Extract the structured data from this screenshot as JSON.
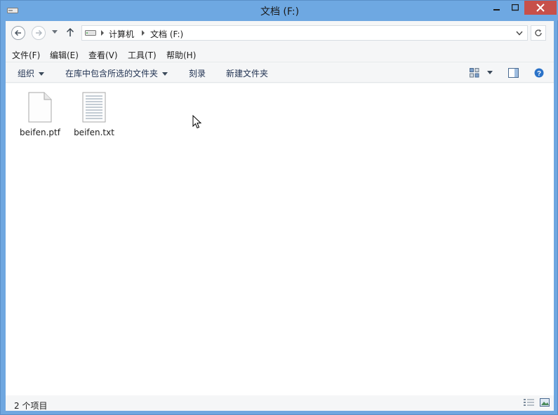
{
  "window": {
    "title": "文档 (F:)"
  },
  "address": {
    "crumbs": [
      "计算机",
      "文档 (F:)"
    ]
  },
  "menu": [
    "文件(F)",
    "编辑(E)",
    "查看(V)",
    "工具(T)",
    "帮助(H)"
  ],
  "toolbar": {
    "organize": "组织",
    "include_library": "在库中包含所选的文件夹",
    "burn": "刻录",
    "new_folder": "新建文件夹"
  },
  "files": [
    {
      "name": "beifen.ptf",
      "icon": "blank-file-icon"
    },
    {
      "name": "beifen.txt",
      "icon": "text-file-icon"
    }
  ],
  "status": {
    "count": "2 个项目"
  },
  "colors": {
    "titlebar": "#6ea8e2",
    "close": "#c7504a",
    "accent": "#1e3050"
  }
}
